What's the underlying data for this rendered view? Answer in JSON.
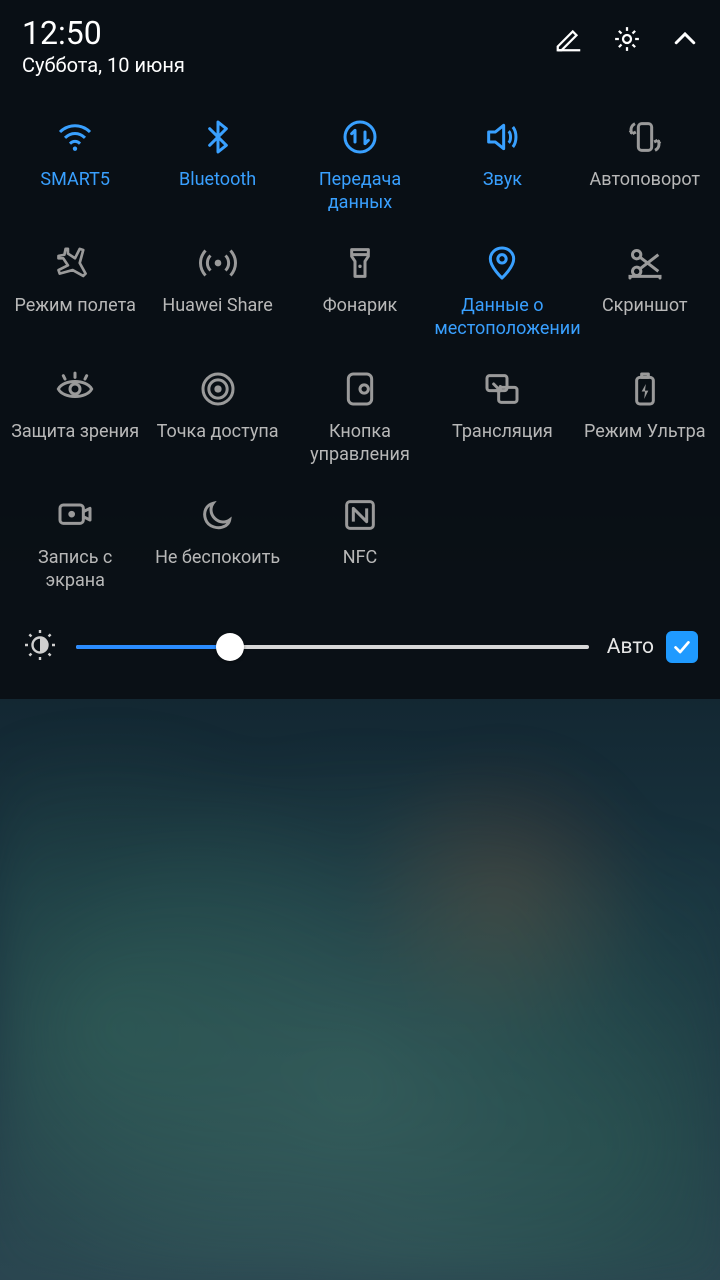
{
  "header": {
    "time": "12:50",
    "date": "Суббота, 10 июня"
  },
  "tiles": {
    "wifi": "SMART5",
    "bluetooth": "Bluetooth",
    "data": "Передача данных",
    "sound": "Звук",
    "rotate": "Автоповорот",
    "airplane": "Режим полета",
    "share": "Huawei Share",
    "flashlight": "Фонарик",
    "location": "Данные о местоположении",
    "screenshot": "Скриншот",
    "eye": "Защита зрения",
    "hotspot": "Точка доступа",
    "floatdock": "Кнопка управления",
    "cast": "Трансляция",
    "ultra": "Режим Ультра",
    "record": "Запись с экрана",
    "dnd": "Не беспокоить",
    "nfc": "NFC"
  },
  "brightness": {
    "auto_label": "Авто",
    "auto_checked": true,
    "value_percent": 30
  },
  "colors": {
    "active": "#39a0ff",
    "inactive": "#9a9a9a"
  }
}
